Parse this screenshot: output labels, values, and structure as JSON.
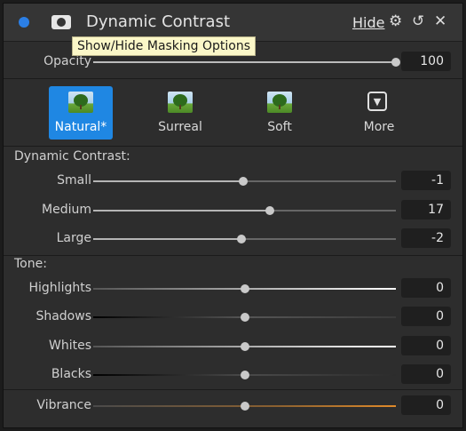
{
  "header": {
    "title": "Dynamic Contrast",
    "hide_label": "Hide",
    "gear_icon": "gear-icon",
    "reset_icon": "reset-icon",
    "close_icon": "close-icon",
    "active_dot_color": "#2b7fe6"
  },
  "tooltip": {
    "text": "Show/Hide Masking Options"
  },
  "opacity": {
    "label": "Opacity",
    "value": "100"
  },
  "presets": [
    {
      "label": "Natural*",
      "selected": true
    },
    {
      "label": "Surreal",
      "selected": false
    },
    {
      "label": "Soft",
      "selected": false
    },
    {
      "label": "More",
      "selected": false
    }
  ],
  "dynamic_contrast": {
    "section_label": "Dynamic Contrast:",
    "sliders": [
      {
        "label": "Small",
        "value": "-1"
      },
      {
        "label": "Medium",
        "value": "17"
      },
      {
        "label": "Large",
        "value": "-2"
      }
    ]
  },
  "tone": {
    "section_label": "Tone:",
    "sliders": [
      {
        "label": "Highlights",
        "value": "0"
      },
      {
        "label": "Shadows",
        "value": "0"
      },
      {
        "label": "Whites",
        "value": "0"
      },
      {
        "label": "Blacks",
        "value": "0"
      },
      {
        "label": "Vibrance",
        "value": "0"
      }
    ]
  },
  "colors": {
    "accent": "#1f87e3",
    "tooltip_bg": "#fbf7c8",
    "vibrance_track": "#e08a2a"
  }
}
